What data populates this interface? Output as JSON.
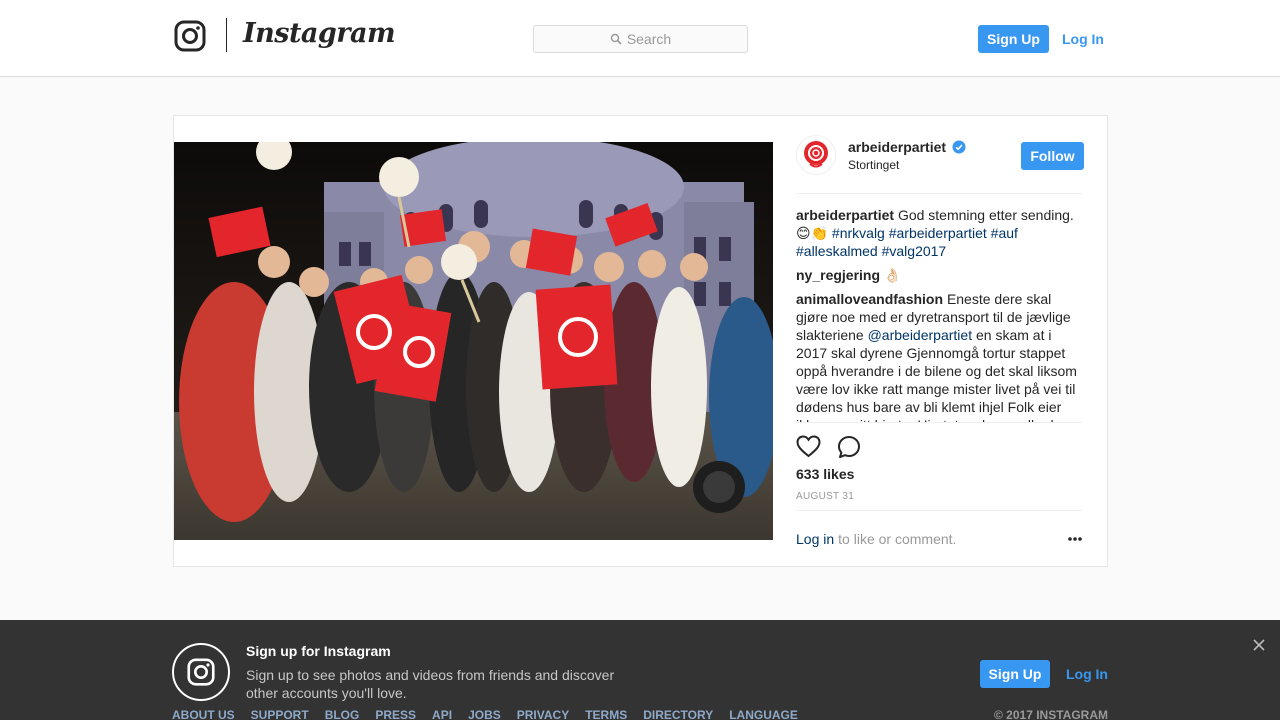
{
  "topnav": {
    "brand": "Instagram",
    "search_placeholder": "Search",
    "signup_label": "Sign Up",
    "login_label": "Log In"
  },
  "post": {
    "username": "arbeiderpartiet",
    "location": "Stortinget",
    "follow_label": "Follow",
    "comments": [
      {
        "user": "arbeiderpartiet",
        "text": "God stemning etter sending. 😊👏 ",
        "tags": "#nrkvalg #arbeiderpartiet #auf #alleskalmed #valg2017"
      },
      {
        "user": "ny_regjering",
        "text": "👌🏻"
      },
      {
        "user": "animalloveandfashion",
        "text_before": "Eneste dere skal gjøre noe med er dyretransport til de jævlige slakteriene ",
        "mention": "@arbeiderpartiet",
        "text_after": " en skam at i 2017 skal dyrene Gjennomgå tortur stappet oppå hverandre i de bilene og det skal liksom være lov ikke ratt mange mister livet på vei til dødens hus bare av bli klemt ihjel Folk eier ikke en gnitt hjerte. Hjertet og hvem eller hva"
      }
    ],
    "likes": "633 likes",
    "date": "AUGUST 31",
    "login_link": "Log in",
    "login_rest": "to like or comment."
  },
  "banner": {
    "title": "Sign up for Instagram",
    "text": "Sign up to see photos and videos from friends and discover other accounts you'll love.",
    "signup_label": "Sign Up",
    "login_label": "Log In",
    "links": [
      "ABOUT US",
      "SUPPORT",
      "BLOG",
      "PRESS",
      "API",
      "JOBS",
      "PRIVACY",
      "TERMS",
      "DIRECTORY",
      "LANGUAGE"
    ],
    "copyright": "© 2017 INSTAGRAM"
  },
  "colors": {
    "accent": "#3897f0",
    "link": "#003569",
    "party_red": "#e3262b"
  }
}
